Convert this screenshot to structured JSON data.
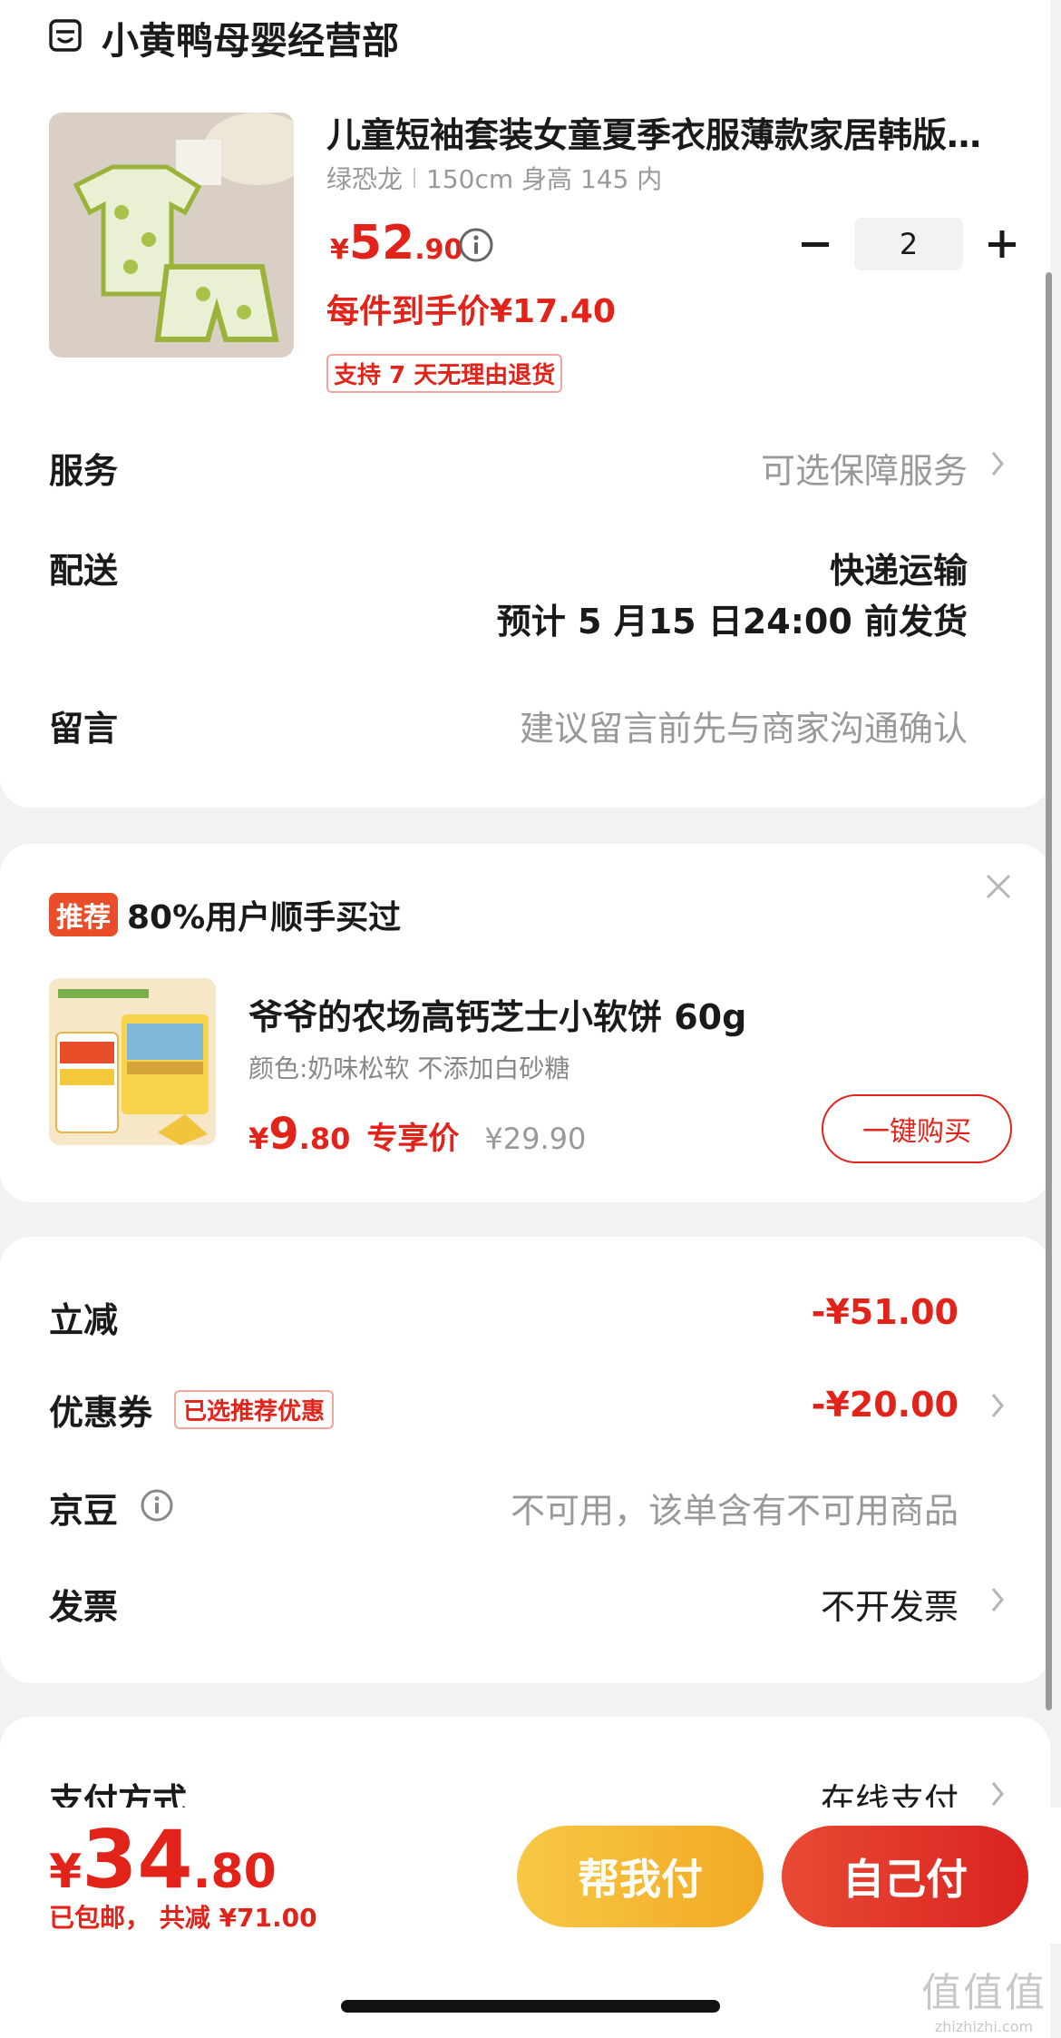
{
  "shop": {
    "name": "小黄鸭母婴经营部",
    "icon": "store-icon"
  },
  "product": {
    "title": "儿童短袖套装女童夏季衣服薄款家居韩版…",
    "spec_color": "绿恐龙",
    "spec_size": "150cm 身高 145 内",
    "price_currency": "¥",
    "price_int": "52",
    "price_dec": ".90",
    "unit_price": "每件到手价¥17.40",
    "return_badge": "支持 7 天无理由退货",
    "quantity": "2"
  },
  "service": {
    "label": "服务",
    "value": "可选保障服务"
  },
  "delivery": {
    "label": "配送",
    "method": "快递运输",
    "eta": "预计 5 月15 日24:00 前发货"
  },
  "message": {
    "label": "留言",
    "placeholder": "建议留言前先与商家沟通确认"
  },
  "recommend": {
    "tag": "推荐",
    "text": "80%用户顺手买过",
    "item_title": "爷爷的农场高钙芝士小软饼 60g",
    "item_spec": "颜色:奶味松软 不添加白砂糖",
    "price_currency": "¥",
    "price_int": "9",
    "price_dec": ".80",
    "price_label": "专享价",
    "orig_price": "¥29.90",
    "buy_label": "一键购买"
  },
  "discounts": {
    "instant_label": "立减",
    "instant_value": "-¥51.00",
    "coupon_label": "优惠券",
    "coupon_tag": "已选推荐优惠",
    "coupon_value": "-¥20.00",
    "jd_bean_label": "京豆",
    "jd_bean_value": "不可用，该单含有不可用商品",
    "invoice_label": "发票",
    "invoice_value": "不开发票"
  },
  "payment": {
    "label": "支付方式",
    "value": "在线支付"
  },
  "footer": {
    "total_currency": "¥",
    "total_int": "34",
    "total_dec": ".80",
    "total_sub": "已包邮， 共减 ¥71.00",
    "help_pay_label": "帮我付",
    "self_pay_label": "自己付"
  },
  "watermark": {
    "glyphs": "值值值",
    "site": "zhizhizhi.com"
  },
  "colors": {
    "accent_red": "#e2231a",
    "gold": "#f2b935"
  }
}
